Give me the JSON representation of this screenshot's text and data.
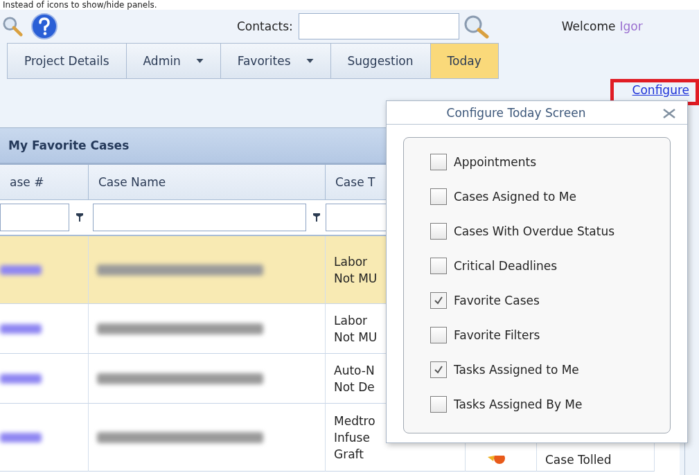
{
  "caption": "Instead of icons to show/hide panels.",
  "toolbar": {
    "contacts_label": "Contacts:",
    "welcome": "Welcome",
    "user": "Igor"
  },
  "tabs": [
    {
      "label": "Project Details",
      "has_menu": false,
      "selected": false
    },
    {
      "label": "Admin",
      "has_menu": true,
      "selected": false
    },
    {
      "label": "Favorites",
      "has_menu": true,
      "selected": false
    },
    {
      "label": "Suggestion",
      "has_menu": false,
      "selected": false
    },
    {
      "label": "Today",
      "has_menu": false,
      "selected": true
    }
  ],
  "configure_link": "Configure",
  "panel": {
    "title": "My Favorite Cases",
    "columns": [
      "ase #",
      "Case Name",
      "Case T"
    ],
    "rows": [
      {
        "selected": true,
        "case_type": [
          "Labor",
          "Not MU"
        ]
      },
      {
        "selected": false,
        "case_type": [
          "Labor",
          "Not MU"
        ]
      },
      {
        "selected": false,
        "case_type": [
          "Auto-N",
          "Not De"
        ]
      },
      {
        "selected": false,
        "case_type": [
          "Medtro",
          "Infuse",
          "Graft"
        ],
        "status": "Case Tolled"
      }
    ]
  },
  "dialog": {
    "title": "Configure Today Screen",
    "options": [
      {
        "label": "Appointments",
        "checked": false
      },
      {
        "label": "Cases Asigned to Me",
        "checked": false
      },
      {
        "label": "Cases With Overdue Status",
        "checked": false
      },
      {
        "label": "Critical Deadlines",
        "checked": false
      },
      {
        "label": "Favorite Cases",
        "checked": true
      },
      {
        "label": "Favorite Filters",
        "checked": false
      },
      {
        "label": "Tasks Assigned to Me",
        "checked": true
      },
      {
        "label": "Tasks Assigned By Me",
        "checked": false
      }
    ]
  }
}
